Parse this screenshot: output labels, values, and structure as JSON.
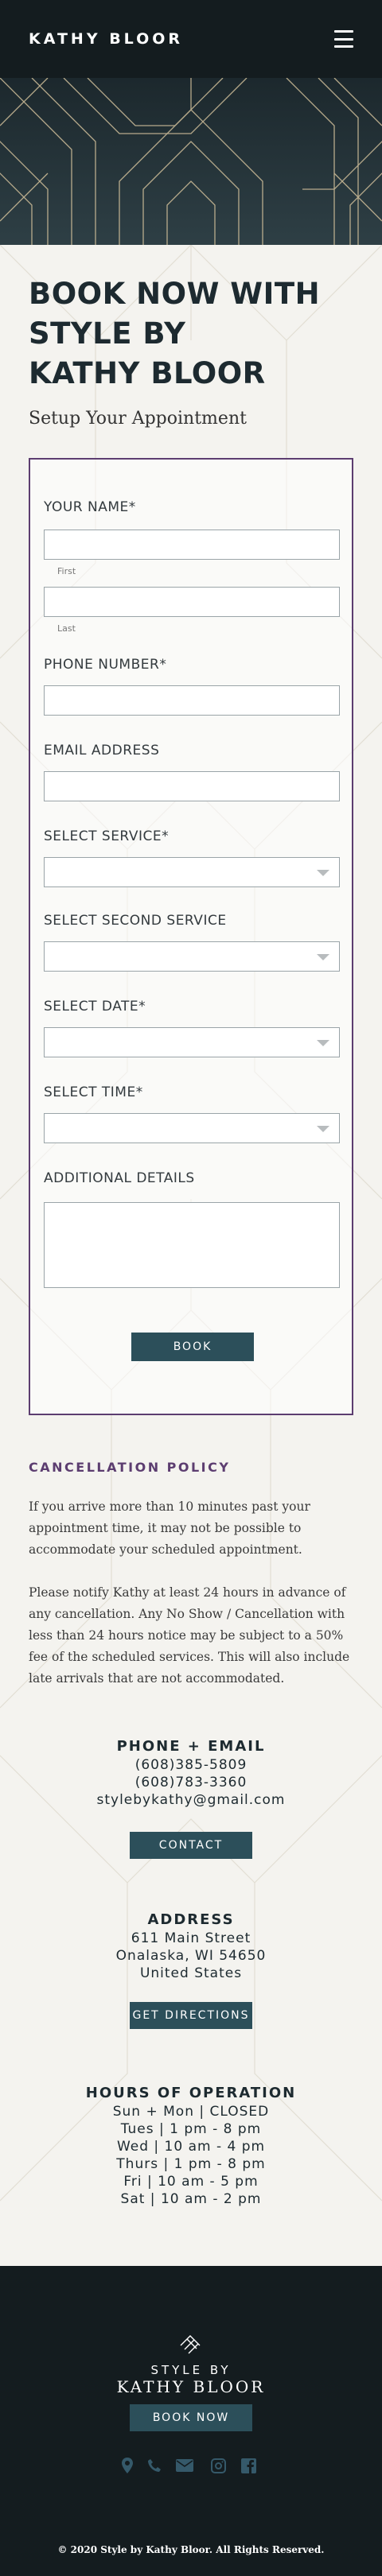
{
  "header": {
    "brand": "KATHY BLOOR"
  },
  "page": {
    "title_line1": "BOOK NOW WITH",
    "title_line2": "STYLE BY",
    "title_line3": "KATHY BLOOR",
    "subtitle": "Setup  Your Appointment"
  },
  "form": {
    "name_label": "YOUR NAME*",
    "first_caption": "First",
    "last_caption": "Last",
    "phone_label": "PHONE NUMBER*",
    "email_label": "EMAIL ADDRESS",
    "service_label": "SELECT SERVICE*",
    "second_service_label": "SELECT SECOND SERVICE",
    "date_label": "SELECT DATE*",
    "time_label": "SELECT TIME*",
    "details_label": "ADDITIONAL DETAILS",
    "submit_label": "BOOK"
  },
  "policy": {
    "title": "CANCELLATION POLICY",
    "p1": "If you arrive more than 10 minutes past your appointment time, it may not be possible to accommodate your scheduled appointment.",
    "p2": "Please notify Kathy at least 24 hours in advance of any cancellation. Any No Show / Cancellation with less than 24 hours notice may be subject to a 50% fee of the scheduled services. This will also include late arrivals that are not accommodated."
  },
  "contact": {
    "title": "PHONE + EMAIL",
    "phone1": "(608)385-5809",
    "phone2": "(608)783-3360",
    "email": "stylebykathy@gmail.com",
    "button": "CONTACT"
  },
  "address": {
    "title": "ADDRESS",
    "line1": "611 Main Street",
    "line2": "Onalaska, WI 54650",
    "line3": "United States",
    "button": "GET DIRECTIONS"
  },
  "hours": {
    "title": "HOURS OF OPERATION",
    "rows": [
      "Sun + Mon | CLOSED",
      "Tues | 1 pm - 8 pm",
      "Wed | 10 am - 4 pm",
      "Thurs | 1 pm - 8 pm",
      "Fri | 10 am - 5 pm",
      "Sat | 10 am - 2 pm"
    ]
  },
  "footer": {
    "logo_line1": "STYLE BY",
    "logo_line2": "KATHY BLOOR",
    "book_button": "BOOK NOW",
    "icons": [
      "location-icon",
      "phone-icon",
      "mail-icon",
      "instagram-icon",
      "facebook-icon"
    ],
    "copyright": "© 2020 Style by Kathy Bloor. All Rights Reserved."
  },
  "colors": {
    "dark": "#141c1f",
    "accent_purple": "#5c3d70",
    "button_teal": "#2c4f5a",
    "icon_teal": "#35596a"
  }
}
